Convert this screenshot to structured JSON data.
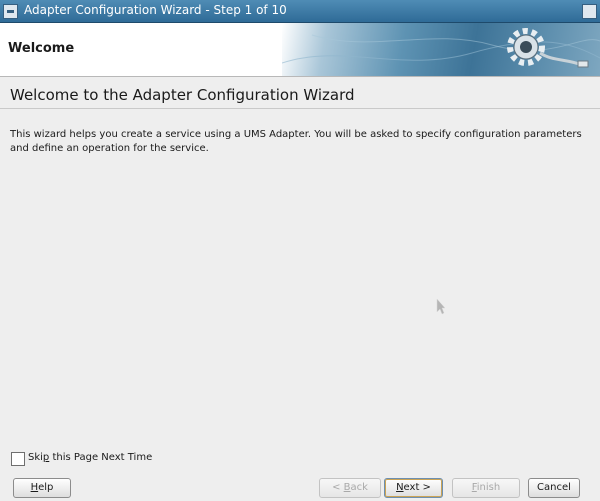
{
  "window": {
    "title": "Adapter Configuration Wizard - Step 1 of 10"
  },
  "header": {
    "title": "Welcome"
  },
  "main": {
    "heading": "Welcome to the Adapter Configuration Wizard",
    "description": "This wizard helps you create a service using a UMS Adapter. You will be asked to specify configuration parameters and define an operation for the service."
  },
  "skip_option": {
    "label_before": "Ski",
    "label_mnemonic": "p",
    "label_after": " this Page Next Time",
    "checked": false
  },
  "buttons": {
    "help": {
      "mnemonic": "H",
      "rest": "elp"
    },
    "back": {
      "prefix": "< ",
      "mnemonic": "B",
      "rest": "ack",
      "enabled": false
    },
    "next": {
      "mnemonic": "N",
      "rest": "ext >",
      "enabled": true
    },
    "finish": {
      "mnemonic": "F",
      "rest": "inish",
      "enabled": false
    },
    "cancel": {
      "label": "Cancel",
      "enabled": true
    }
  },
  "colors": {
    "titlebar": "#3a78a4",
    "header_art": "#3d7397",
    "background": "#eeeeee"
  },
  "icons": [
    "window-menu-icon",
    "window-close-icon",
    "gear-plug-icon",
    "mouse-pointer-icon"
  ]
}
